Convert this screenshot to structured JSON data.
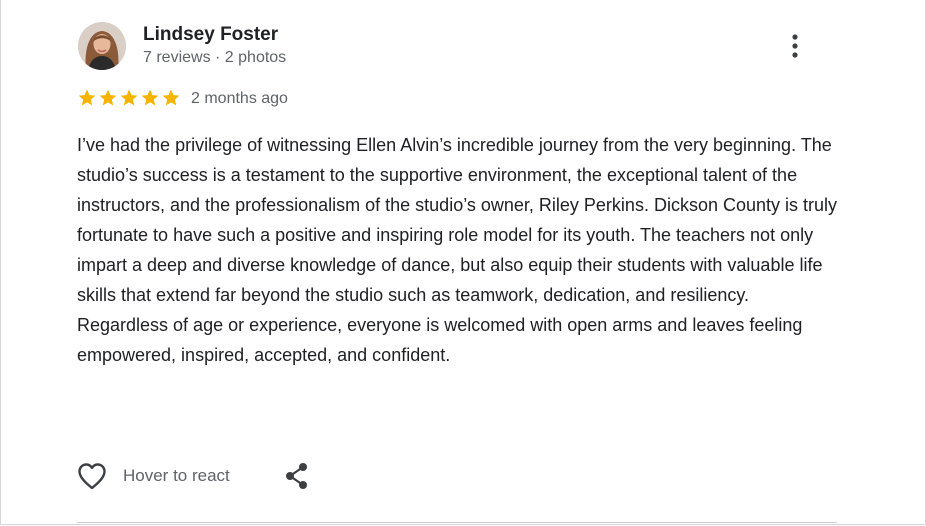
{
  "reviewer": {
    "name": "Lindsey Foster",
    "meta": "7 reviews · 2 photos"
  },
  "rating": {
    "stars": 5,
    "max": 5,
    "star_color": "#F4B400"
  },
  "date": "2 months ago",
  "review": {
    "text": "I’ve had the privilege of witnessing Ellen Alvin’s incredible journey from the very beginning. The studio’s success is a testament to the supportive environment, the exceptional talent of the instructors, and the professionalism of the studio’s owner, Riley Perkins. Dickson County is truly fortunate to have such a positive and inspiring role model for its youth. The teachers not only impart a deep and diverse knowledge of dance, but also equip their students with valuable life skills that extend far beyond the studio such as teamwork, dedication, and resiliency. Regardless of age or experience, everyone is welcomed with open arms and leaves feeling empowered, inspired, accepted, and confident."
  },
  "actions": {
    "react_label": "Hover to react",
    "react_icon": "heart-outline-icon",
    "share_icon": "share-icon",
    "more_icon": "more-vertical-icon"
  }
}
